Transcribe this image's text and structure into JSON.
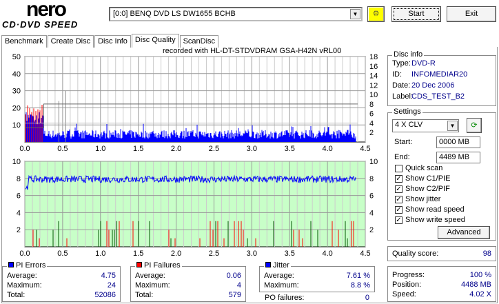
{
  "app": {
    "logo_top": "nero",
    "logo_bottom": "CD·DVD SPEED"
  },
  "toolbar": {
    "drive": "[0:0]  BENQ DVD LS DW1655 BCHB",
    "start": "Start",
    "exit": "Exit"
  },
  "tabs": [
    "Benchmark",
    "Create Disc",
    "Disc Info",
    "Disc Quality",
    "ScanDisc"
  ],
  "active_tab": "Disc Quality",
  "recorded_with": "recorded with HL-DT-STDVDRAM GSA-H42N  vRL00",
  "disc_info": {
    "title": "Disc info",
    "rows": [
      {
        "label": "Type:",
        "value": "DVD-R"
      },
      {
        "label": "ID:",
        "value": "INFOMEDIAR20"
      },
      {
        "label": "Date:",
        "value": "20 Dec 2006"
      },
      {
        "label": "Label:",
        "value": "CDS_TEST_B2"
      }
    ]
  },
  "settings": {
    "title": "Settings",
    "speed": "4 X CLV",
    "start_label": "Start:",
    "start": "0000 MB",
    "end_label": "End:",
    "end": "4489 MB",
    "checks": [
      {
        "label": "Quick scan",
        "checked": false
      },
      {
        "label": "Show C1/PIE",
        "checked": true
      },
      {
        "label": "Show C2/PIF",
        "checked": true
      },
      {
        "label": "Show jitter",
        "checked": true
      },
      {
        "label": "Show read speed",
        "checked": true
      },
      {
        "label": "Show write speed",
        "checked": true
      }
    ],
    "advanced": "Advanced"
  },
  "quality": {
    "label": "Quality score:",
    "value": "98"
  },
  "pi_errors": {
    "title": "PI Errors",
    "color": "#0000ff",
    "rows": [
      {
        "label": "Average:",
        "value": "4.75"
      },
      {
        "label": "Maximum:",
        "value": "24"
      },
      {
        "label": "Total:",
        "value": "52086"
      }
    ]
  },
  "pi_failures": {
    "title": "PI Failures",
    "color": "#ff0000",
    "rows": [
      {
        "label": "Average:",
        "value": "0.06"
      },
      {
        "label": "Maximum:",
        "value": "4"
      },
      {
        "label": "Total:",
        "value": "579"
      }
    ]
  },
  "jitter": {
    "title": "Jitter",
    "color": "#0000ff",
    "rows": [
      {
        "label": "Average:",
        "value": "7.61 %"
      },
      {
        "label": "Maximum:",
        "value": "8.8 %"
      }
    ],
    "po_label": "PO failures:",
    "po_value": "0"
  },
  "progress": {
    "rows": [
      {
        "label": "Progress:",
        "value": "100 %"
      },
      {
        "label": "Position:",
        "value": "4488 MB"
      },
      {
        "label": "Speed:",
        "value": "4.02 X"
      }
    ]
  },
  "chart_data": [
    {
      "type": "bar",
      "title": "PI Errors / Read speed",
      "x_ticks": [
        "0.0",
        "0.5",
        "1.0",
        "1.5",
        "2.0",
        "2.5",
        "3.0",
        "3.5",
        "4.0",
        "4.5"
      ],
      "xlim": [
        0,
        4.5
      ],
      "y_ticks_left": [
        "10",
        "20",
        "30",
        "40",
        "50"
      ],
      "ylim_left": [
        0,
        50
      ],
      "y_ticks_right": [
        "2",
        "4",
        "6",
        "8",
        "10",
        "12",
        "14",
        "16",
        "18"
      ],
      "ylim_right": [
        0,
        18
      ],
      "pie_avg": 4.75,
      "pie_max": 24,
      "read_speed_x": 4.0,
      "data_end_gb": 4.38
    },
    {
      "type": "bar",
      "title": "PI Failures / Jitter",
      "x_ticks": [
        "0.0",
        "0.5",
        "1.0",
        "1.5",
        "2.0",
        "2.5",
        "3.0",
        "3.5",
        "4.0",
        "4.5"
      ],
      "xlim": [
        0,
        4.5
      ],
      "y_ticks_left": [
        "2",
        "4",
        "6",
        "8",
        "10"
      ],
      "ylim_left": [
        0,
        10
      ],
      "y_ticks_right": [
        "2",
        "4",
        "6",
        "8",
        "10"
      ],
      "ylim_right": [
        0,
        10
      ],
      "pif_max": 4,
      "jitter_avg": 7.61
    }
  ]
}
